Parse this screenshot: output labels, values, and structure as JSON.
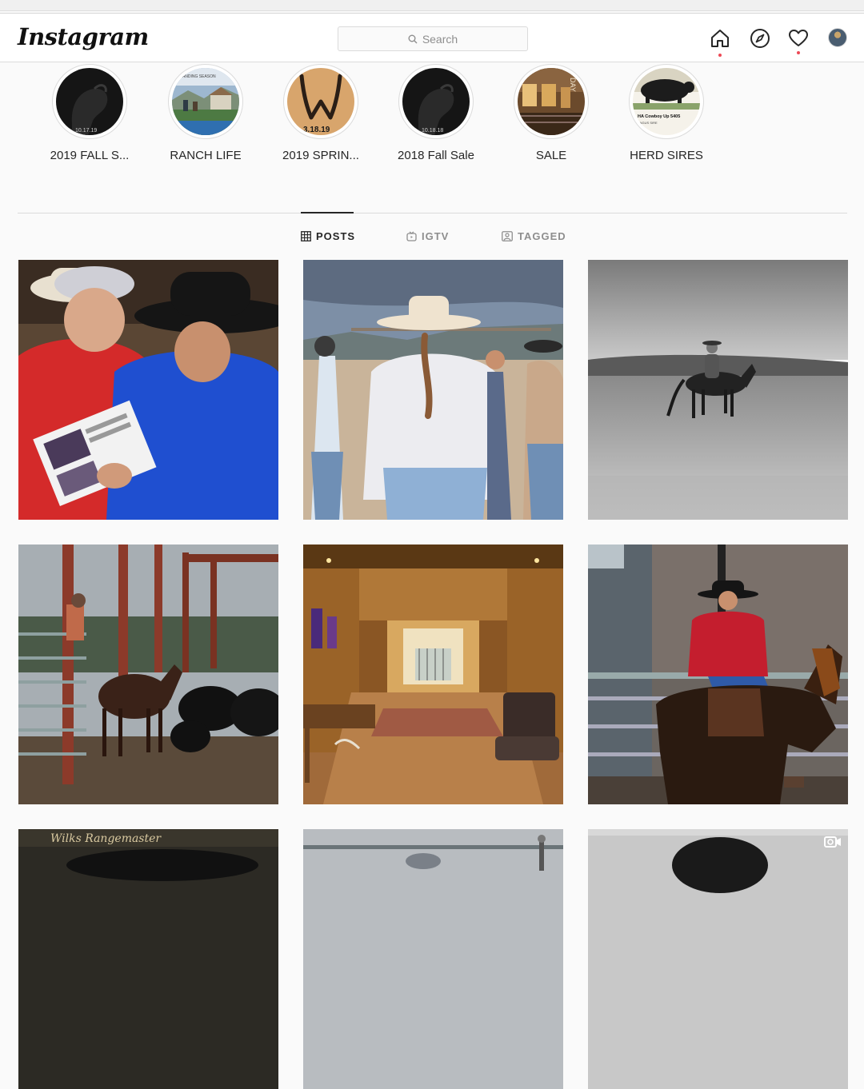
{
  "nav": {
    "logo": "Instagram",
    "search_placeholder": "Search",
    "icons": [
      "home-icon",
      "explore-icon",
      "heart-icon",
      "profile-avatar"
    ]
  },
  "highlights": [
    {
      "label": "2019 FALL S..."
    },
    {
      "label": "RANCH LIFE"
    },
    {
      "label": "2019 SPRIN..."
    },
    {
      "label": "2018 Fall Sale"
    },
    {
      "label": "SALE"
    },
    {
      "label": "HERD SIRES"
    }
  ],
  "tabs": [
    {
      "label": "POSTS",
      "icon": "grid-icon",
      "active": true
    },
    {
      "label": "IGTV",
      "icon": "igtv-icon",
      "active": false
    },
    {
      "label": "TAGGED",
      "icon": "tagged-icon",
      "active": false
    }
  ],
  "posts": [
    {
      "name": "post-cattle-sale-catalog"
    },
    {
      "name": "post-ranch-crowd"
    },
    {
      "name": "post-horse-rider-field"
    },
    {
      "name": "post-corral-horse-cattle"
    },
    {
      "name": "post-sale-barn-interior"
    },
    {
      "name": "post-young-rider-horse"
    },
    {
      "name": "post-row3-a"
    },
    {
      "name": "post-row3-b"
    },
    {
      "name": "post-row3-c-video"
    }
  ],
  "colors": {
    "accent_dot": "#ed4956",
    "border": "#dbdbdb",
    "text": "#262626",
    "muted": "#8e8e8e"
  }
}
